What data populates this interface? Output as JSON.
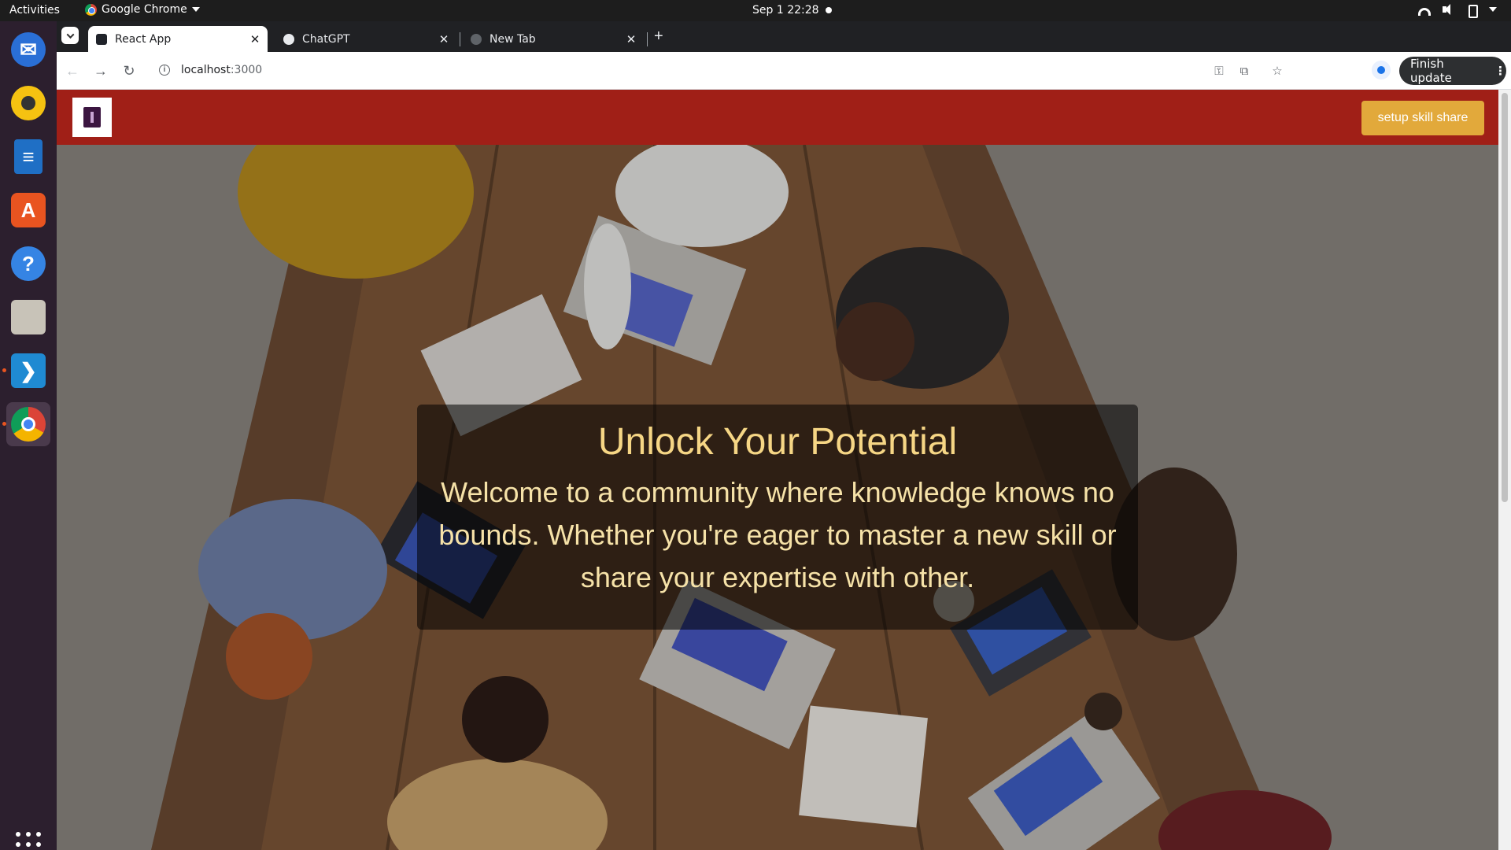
{
  "system": {
    "activities": "Activities",
    "app_name": "Google Chrome",
    "clock": "Sep 1  22:28"
  },
  "dock": {
    "items": [
      {
        "name": "thunderbird-icon",
        "color": "#2a6fd6"
      },
      {
        "name": "rhythmbox-icon",
        "color": "#f5c211"
      },
      {
        "name": "libreoffice-writer-icon",
        "color": "#1f6fc5"
      },
      {
        "name": "app-center-icon",
        "color": "#e95420"
      },
      {
        "name": "help-icon",
        "color": "#3584e4"
      },
      {
        "name": "files-icon",
        "color": "#c8c3b8"
      },
      {
        "name": "vscode-icon",
        "color": "#1f8ad2"
      },
      {
        "name": "chrome-icon",
        "color": "#4285f4"
      }
    ]
  },
  "browser": {
    "tabs": [
      {
        "title": "React App",
        "active": true
      },
      {
        "title": "ChatGPT",
        "active": false
      },
      {
        "title": "New Tab",
        "active": false
      }
    ],
    "url_host": "localhost",
    "url_port": ":3000",
    "finish_update": "Finish update"
  },
  "site": {
    "nav_color": "#a01f17",
    "setup_button": "setup skill share",
    "hero": {
      "title": "Unlock Your Potential",
      "text": "Welcome to a community where knowledge knows no bounds. Whether you're eager to master a new skill or share your expertise with other."
    }
  }
}
